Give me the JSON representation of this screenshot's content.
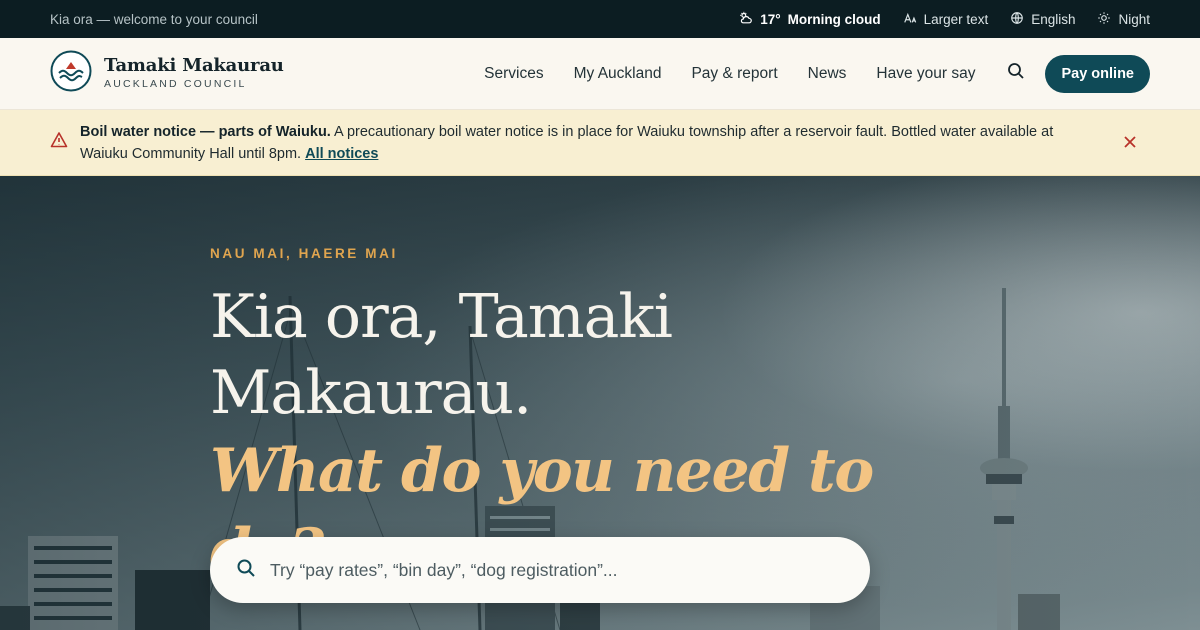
{
  "utility": {
    "greeting": "Kia ora — welcome to your council",
    "weather_temp": "17°",
    "weather_desc": "Morning cloud",
    "larger_text": "Larger text",
    "language": "English",
    "theme": "Night"
  },
  "brand": {
    "name": "Tamaki Makaurau",
    "subtitle": "AUCKLAND COUNCIL"
  },
  "nav": {
    "items": [
      "Services",
      "My Auckland",
      "Pay & report",
      "News",
      "Have your say"
    ],
    "pay_button": "Pay online"
  },
  "notice": {
    "title": "Boil water notice — parts of Waiuku.",
    "body": " A precautionary boil water notice is in place for Waiuku township after a reservoir fault. Bottled water available at Waiuku Community Hall until 8pm. ",
    "link": "All notices"
  },
  "hero": {
    "eyebrow": "NAU MAI, HAERE MAI",
    "heading_line1": "Kia ora, Tamaki",
    "heading_line2": "Makaurau.",
    "heading_accent": "What do you need to do?",
    "search_placeholder": "Try “pay rates”, “bin day”, “dog registration”..."
  },
  "colors": {
    "accent": "#0f4a57",
    "eyebrow": "#e0a54f",
    "heading_accent": "#f3c483",
    "notice_bg": "#f8efd2",
    "warning": "#b8322a"
  }
}
